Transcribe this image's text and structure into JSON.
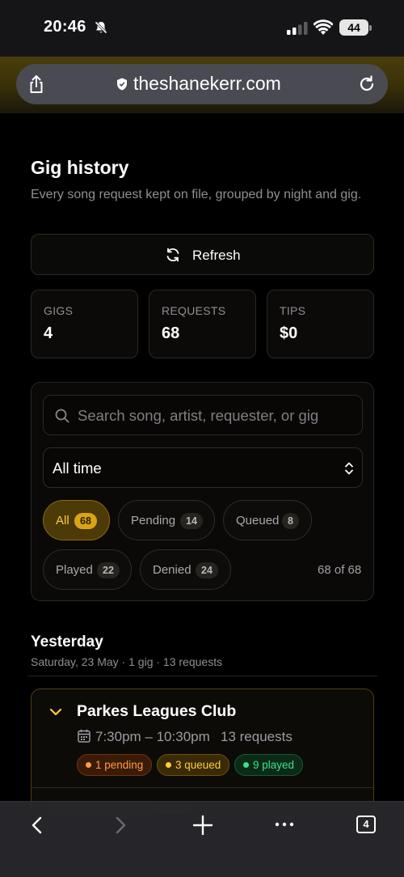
{
  "status_bar": {
    "time": "20:46",
    "battery": "44"
  },
  "browser": {
    "url": "theshanekerr.com",
    "tab_count": "4"
  },
  "page": {
    "title": "Gig history",
    "subtitle": "Every song request kept on file, grouped by night and gig.",
    "refresh_label": "Refresh"
  },
  "stats": [
    {
      "label": "GIGS",
      "value": "4"
    },
    {
      "label": "REQUESTS",
      "value": "68"
    },
    {
      "label": "TIPS",
      "value": "$0"
    }
  ],
  "filters": {
    "search_placeholder": "Search song, artist, requester, or gig",
    "range_value": "All time",
    "chips": [
      {
        "label": "All",
        "count": "68",
        "active": true
      },
      {
        "label": "Pending",
        "count": "14"
      },
      {
        "label": "Queued",
        "count": "8"
      },
      {
        "label": "Played",
        "count": "22"
      },
      {
        "label": "Denied",
        "count": "24"
      }
    ],
    "result_count": "68 of 68"
  },
  "section": {
    "title": "Yesterday",
    "meta": "Saturday, 23 May · 1 gig · 13 requests"
  },
  "gig": {
    "name": "Parkes Leagues Club",
    "time": "7:30pm – 10:30pm",
    "requests": "13 requests",
    "pills": {
      "pending": "1 pending",
      "queued": "3 queued",
      "played": "9 played"
    }
  },
  "colors": {
    "accent": "#ffcd3c",
    "pending": "#ff9a4d",
    "played": "#3fe08a"
  },
  "icons": [
    "bell-slash-icon",
    "signal-icon",
    "wifi-icon",
    "share-icon",
    "shield-icon",
    "reload-icon",
    "refresh-icon",
    "search-icon",
    "updown-icon",
    "chevron-down-icon",
    "calendar-icon",
    "back-icon",
    "forward-icon",
    "plus-icon",
    "more-icon",
    "tabs-icon"
  ]
}
